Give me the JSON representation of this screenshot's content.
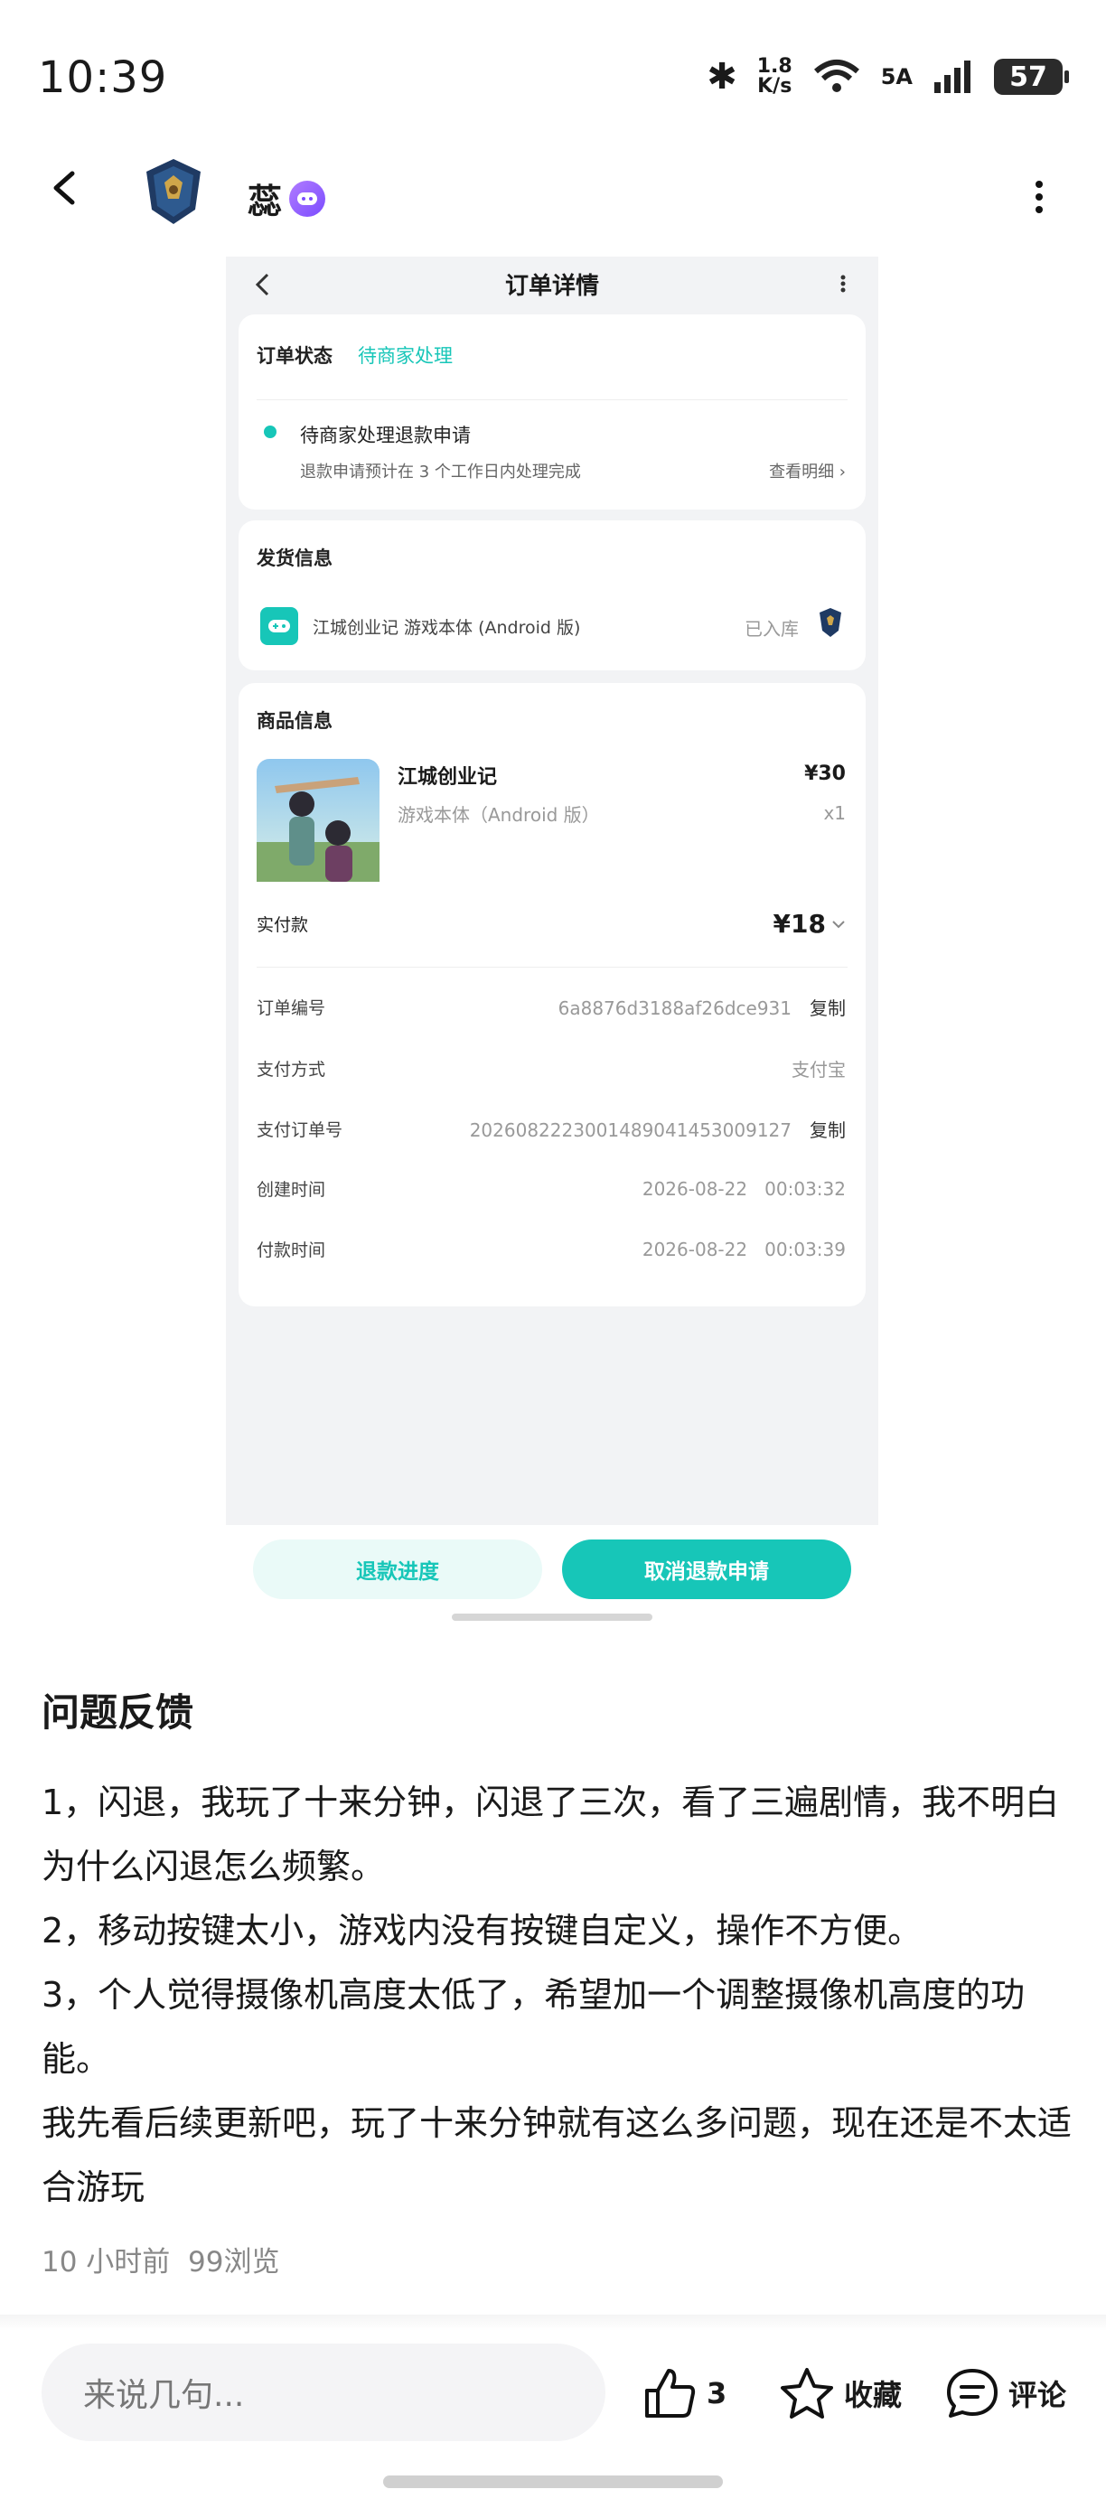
{
  "status": {
    "time": "10:39",
    "speed_top": "1.8",
    "speed_bottom": "K/s",
    "network": "5A",
    "battery": "57"
  },
  "header": {
    "username": "蕊"
  },
  "order": {
    "title": "订单详情",
    "status_label": "订单状态",
    "status_value": "待商家处理",
    "step_title": "待商家处理退款申请",
    "step_desc": "退款申请预计在 3 个工作日内处理完成",
    "step_link": "查看明细 ›",
    "ship_label": "发货信息",
    "ship_item": "江城创业记 游戏本体 (Android 版)",
    "ship_status": "已入库",
    "goods_label": "商品信息",
    "goods_name": "江城创业记",
    "goods_variant": "游戏本体（Android 版）",
    "goods_price": "¥30",
    "goods_qty": "x1",
    "paid_label": "实付款",
    "paid_value": "¥18",
    "rows": [
      {
        "label": "订单编号",
        "value": "6a8876d3188af26dce931",
        "copy": "复制"
      },
      {
        "label": "支付方式",
        "value": "支付宝",
        "copy": ""
      },
      {
        "label": "支付订单号",
        "value": "2026082223001489041453009127",
        "copy": "复制"
      },
      {
        "label": "创建时间",
        "value": "2026-08-22   00:03:32",
        "copy": ""
      },
      {
        "label": "付款时间",
        "value": "2026-08-22   00:03:39",
        "copy": ""
      }
    ],
    "btn_progress": "退款进度",
    "btn_cancel": "取消退款申请"
  },
  "post": {
    "title": "问题反馈",
    "lines": [
      "1，闪退，我玩了十来分钟，闪退了三次，看了三遍剧情，我不明白为什么闪退怎么频繁。",
      "2，移动按键太小，游戏内没有按键自定义，操作不方便。",
      "3，个人觉得摄像机高度太低了，希望加一个调整摄像机高度的功能。",
      "我先看后续更新吧，玩了十来分钟就有这么多问题，现在还是不太适合游玩"
    ],
    "time": "10 小时前",
    "views": "99浏览"
  },
  "bottom": {
    "placeholder": "来说几句...",
    "likes": "3",
    "fav": "收藏",
    "comment": "评论"
  },
  "colors": {
    "accent": "#17c6b8",
    "badge": "#8a5cff"
  }
}
